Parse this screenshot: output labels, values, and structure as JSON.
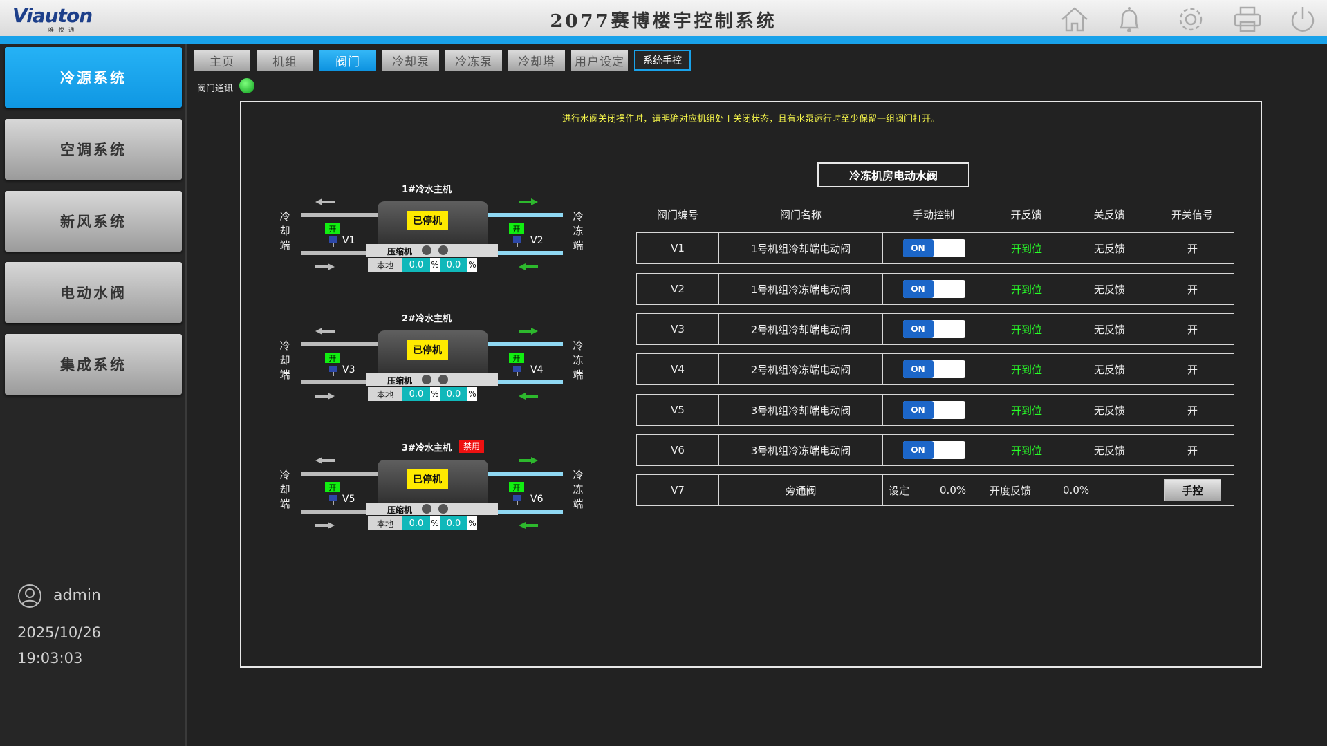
{
  "header": {
    "logo_text": "Viauton",
    "logo_sub": "唯 悦 通",
    "title": "2077赛博楼宇控制系统",
    "icons": [
      "home-icon",
      "bell-icon",
      "gear-icon",
      "printer-icon",
      "power-icon"
    ]
  },
  "sidebar": {
    "items": [
      {
        "label": "冷源系统",
        "active": true
      },
      {
        "label": "空调系统",
        "active": false
      },
      {
        "label": "新风系统",
        "active": false
      },
      {
        "label": "电动水阀",
        "active": false
      },
      {
        "label": "集成系统",
        "active": false
      }
    ],
    "user": "admin",
    "date": "2025/10/26",
    "time": "19:03:03"
  },
  "tabs": [
    {
      "label": "主页"
    },
    {
      "label": "机组"
    },
    {
      "label": "阀门",
      "active": true
    },
    {
      "label": "冷却泵"
    },
    {
      "label": "冷冻泵"
    },
    {
      "label": "冷却塔"
    },
    {
      "label": "用户设定"
    },
    {
      "label": "系统手控",
      "outline": true
    }
  ],
  "comm": {
    "label": "阀门通讯",
    "status_color": "#11cc22"
  },
  "warning": "进行水阀关闭操作时，请明确对应机组处于关闭状态，且有水泵运行时至少保留一组阀门打开。",
  "chillers": [
    {
      "title": "1#冷水主机",
      "status": "已停机",
      "left_side": "冷却端",
      "right_side": "冷冻端",
      "valve_left": "V1",
      "valve_right": "V2",
      "open_left": "开",
      "open_right": "开",
      "compressor": "压缩机",
      "local": "本地",
      "val1": "0.0",
      "val2": "0.0",
      "unit": "%",
      "disabled": ""
    },
    {
      "title": "2#冷水主机",
      "status": "已停机",
      "left_side": "冷却端",
      "right_side": "冷冻端",
      "valve_left": "V3",
      "valve_right": "V4",
      "open_left": "开",
      "open_right": "开",
      "compressor": "压缩机",
      "local": "本地",
      "val1": "0.0",
      "val2": "0.0",
      "unit": "%",
      "disabled": ""
    },
    {
      "title": "3#冷水主机",
      "status": "已停机",
      "left_side": "冷却端",
      "right_side": "冷冻端",
      "valve_left": "V5",
      "valve_right": "V6",
      "open_left": "开",
      "open_right": "开",
      "compressor": "压缩机",
      "local": "本地",
      "val1": "0.0",
      "val2": "0.0",
      "unit": "%",
      "disabled": "禁用"
    }
  ],
  "valve_table": {
    "title": "冷冻机房电动水阀",
    "headers": [
      "阀门编号",
      "阀门名称",
      "手动控制",
      "开反馈",
      "关反馈",
      "开关信号"
    ],
    "rows": [
      {
        "id": "V1",
        "name": "1号机组冷却端电动阀",
        "toggle": "ON",
        "open_fb": "开到位",
        "close_fb": "无反馈",
        "signal": "开"
      },
      {
        "id": "V2",
        "name": "1号机组冷冻端电动阀",
        "toggle": "ON",
        "open_fb": "开到位",
        "close_fb": "无反馈",
        "signal": "开"
      },
      {
        "id": "V3",
        "name": "2号机组冷却端电动阀",
        "toggle": "ON",
        "open_fb": "开到位",
        "close_fb": "无反馈",
        "signal": "开"
      },
      {
        "id": "V4",
        "name": "2号机组冷冻端电动阀",
        "toggle": "ON",
        "open_fb": "开到位",
        "close_fb": "无反馈",
        "signal": "开"
      },
      {
        "id": "V5",
        "name": "3号机组冷却端电动阀",
        "toggle": "ON",
        "open_fb": "开到位",
        "close_fb": "无反馈",
        "signal": "开"
      },
      {
        "id": "V6",
        "name": "3号机组冷冻端电动阀",
        "toggle": "ON",
        "open_fb": "开到位",
        "close_fb": "无反馈",
        "signal": "开"
      }
    ],
    "bypass": {
      "id": "V7",
      "name": "旁通阀",
      "set_label": "设定",
      "set_value": "0.0%",
      "fb_label": "开度反馈",
      "fb_value": "0.0%",
      "button": "手控"
    }
  }
}
